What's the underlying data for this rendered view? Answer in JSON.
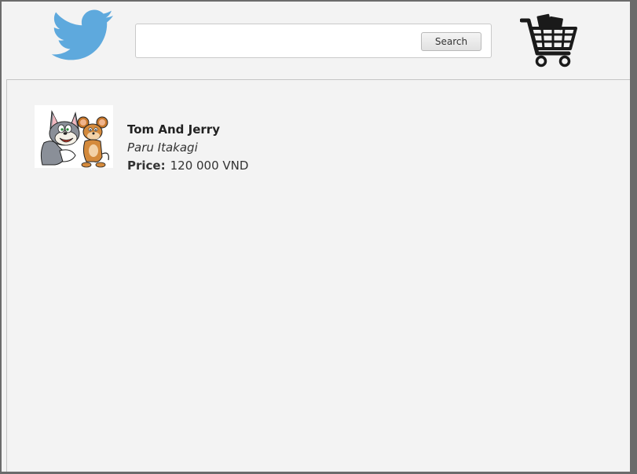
{
  "header": {
    "logo_icon": "twitter-bird-icon",
    "brand_color": "#5ea9dd",
    "search": {
      "value": "",
      "placeholder": "",
      "button_label": "Search"
    },
    "cart_icon": "shopping-cart-icon"
  },
  "products": [
    {
      "image_icon": "tom-and-jerry-image",
      "title": "Tom And Jerry",
      "author": "Paru Itakagi",
      "price_label": "Price:",
      "price_value": "120 000 VND"
    }
  ]
}
